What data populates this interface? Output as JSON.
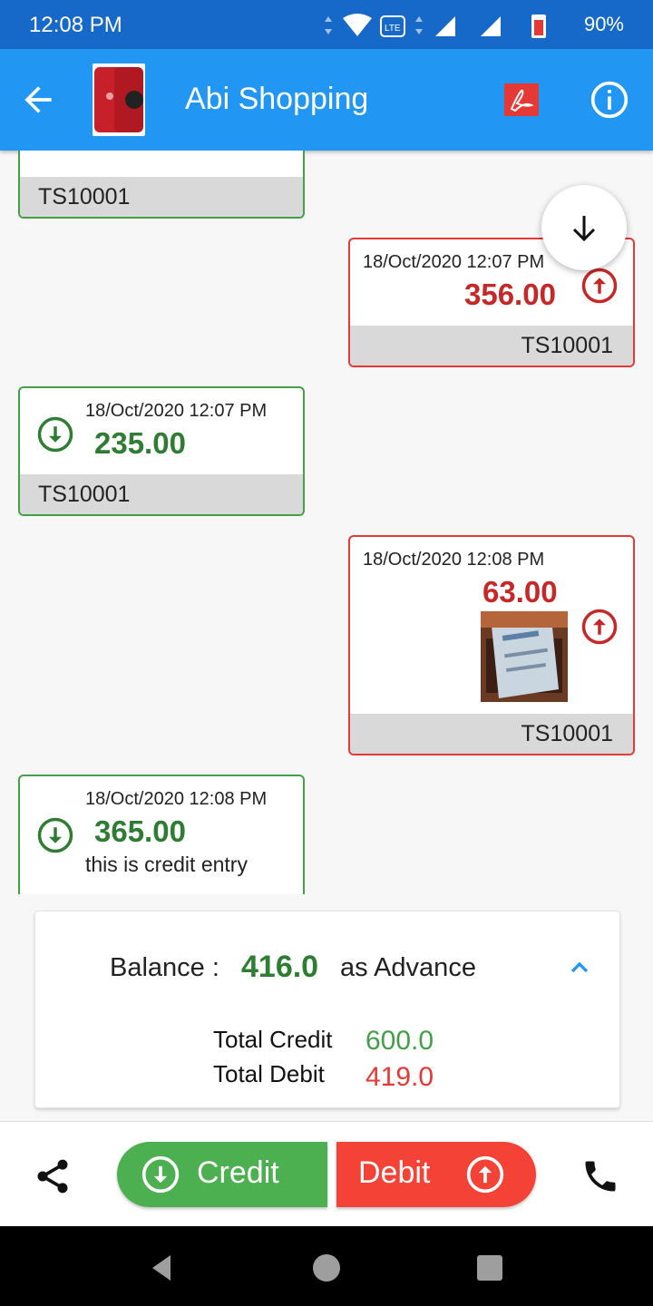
{
  "status_bar": {
    "time": "12:08 PM",
    "battery": "90%",
    "icons": [
      "data-arrows-icon",
      "wifi-icon",
      "volte-icon",
      "signal-icon",
      "signal-icon",
      "battery-charging-icon"
    ]
  },
  "app_bar": {
    "title": "Abi Shopping",
    "avatar": "phone-product-image",
    "actions": [
      "pdf-icon",
      "info-icon"
    ]
  },
  "colors": {
    "primary": "#2196f3",
    "credit": "#4caf50",
    "debit": "#f44336",
    "credit_text": "#2e7d32",
    "debit_text": "#c62828"
  },
  "transactions": [
    {
      "type": "credit",
      "date": "",
      "amount": "",
      "note": "",
      "ref": "TS10001"
    },
    {
      "type": "debit",
      "date": "18/Oct/2020 12:07 PM",
      "amount": "356.00",
      "note": "",
      "ref": "TS10001"
    },
    {
      "type": "credit",
      "date": "18/Oct/2020 12:07 PM",
      "amount": "235.00",
      "note": "",
      "ref": "TS10001"
    },
    {
      "type": "debit",
      "date": "18/Oct/2020 12:08 PM",
      "amount": "63.00",
      "note": "",
      "ref": "TS10001",
      "attachment": "receipt-photo"
    },
    {
      "type": "credit",
      "date": "18/Oct/2020 12:08 PM",
      "amount": "365.00",
      "note": "this is credit entry",
      "ref": ""
    }
  ],
  "balance": {
    "label": "Balance :",
    "value": "416.0",
    "suffix": "as Advance",
    "total_credit_label": "Total Credit",
    "total_credit_value": "600.0",
    "total_debit_label": "Total Debit",
    "total_debit_value": "419.0"
  },
  "actions": {
    "credit_label": "Credit",
    "debit_label": "Debit"
  }
}
